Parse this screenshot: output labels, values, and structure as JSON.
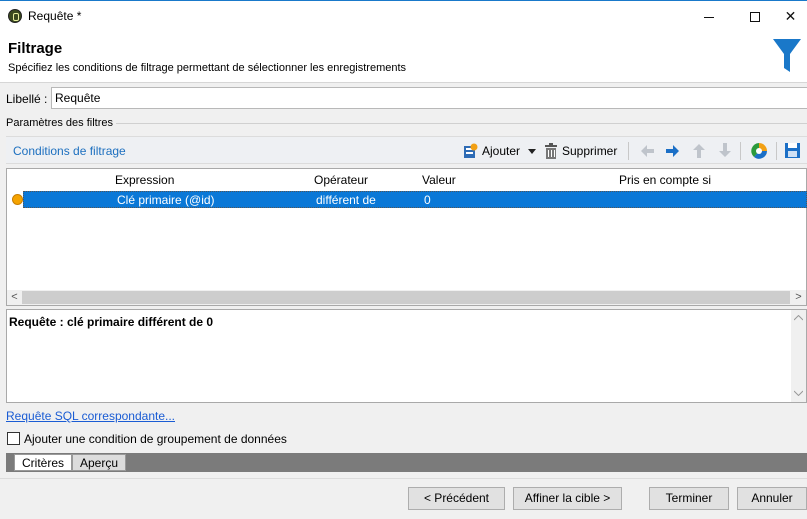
{
  "window": {
    "title": "Requête *",
    "min_glyph": "–",
    "close_glyph": "✕"
  },
  "header": {
    "title": "Filtrage",
    "subtitle": "Spécifiez les conditions de filtrage permettant de sélectionner les enregistrements",
    "icon": "funnel-icon",
    "icon_color": "#1a78c9"
  },
  "libelle": {
    "label": "Libellé :",
    "value": "Requête"
  },
  "params_label": "Paramètres des filtres",
  "toolbar": {
    "title": "Conditions de filtrage",
    "add_label": "Ajouter",
    "delete_label": "Supprimer"
  },
  "grid": {
    "columns": [
      "Expression",
      "Opérateur",
      "Valeur",
      "Pris en compte si"
    ],
    "rows": [
      {
        "expression": "Clé primaire (@id)",
        "operator": "différent de",
        "value": "0",
        "condition": ""
      }
    ],
    "selected_color": "#0a78d7",
    "status_color": "#f5a300"
  },
  "description": "Requête : clé primaire différent de 0",
  "sql_link": "Requête SQL correspondante...",
  "grouping_checkbox": {
    "label": "Ajouter une condition de groupement de données",
    "checked": false
  },
  "tabs": [
    "Critères",
    "Aperçu"
  ],
  "buttons": {
    "previous": "< Précédent",
    "refine": "Affiner la cible >",
    "finish": "Terminer",
    "cancel": "Annuler"
  }
}
